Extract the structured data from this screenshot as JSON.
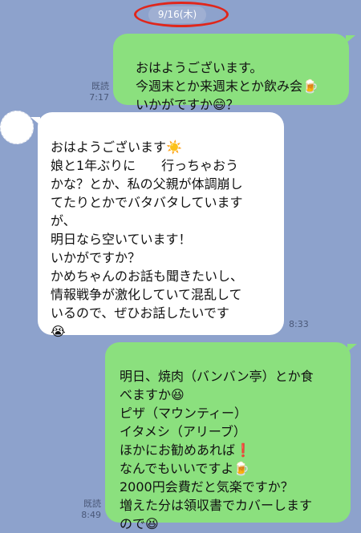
{
  "chat": {
    "date": "9/16(木)",
    "messages": [
      {
        "id": "m1",
        "direction": "outgoing",
        "text": "おはようございます。\n今週末とか来週末とか飲み会🍺\nいかがですか😄？",
        "read_label": "既読",
        "time": "7:17"
      },
      {
        "id": "m2",
        "direction": "incoming",
        "text": "おはようございます☀️\n娘と1年ぶりに　　行っちゃおう\nかな？とか、私の父親が体調崩し\nてたりとかでバタバタしています\nが、\n明日なら空いています！\nいかがですか？\nかめちゃんのお話も聞きたいし、\n情報戦争が激化していて混乱して\nいるので、ぜひお話したいです\n😭",
        "time": "8:33"
      },
      {
        "id": "m3",
        "direction": "outgoing",
        "text": "明日、焼肉（バンバン亭）とか食\nべますか😆\nピザ（マウンティー）\nイタメシ（アリーブ）\nほかにお勧めあれば❗\nなんでもいいですよ🍺\n2000円会費だと気楽ですか？\n増えた分は領収書でカバーします\nので😆",
        "read_label": "既読",
        "time": "8:49"
      }
    ]
  },
  "colors": {
    "background": "#8DA2CC",
    "outgoing_bubble": "#8BE07E",
    "incoming_bubble": "#FFFFFF",
    "highlight_circle": "#E0261B"
  }
}
